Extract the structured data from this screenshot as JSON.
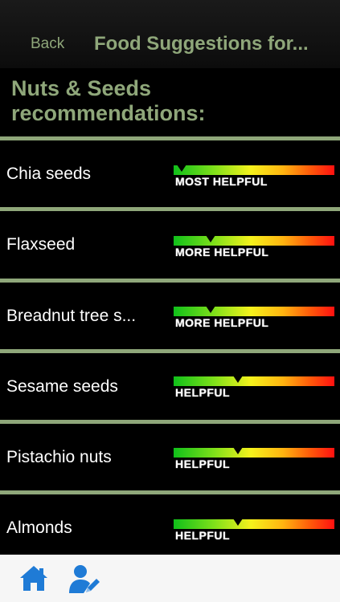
{
  "nav": {
    "back_label": "Back",
    "title": "Food Suggestions for..."
  },
  "heading": "Nuts & Seeds recommendations:",
  "items": [
    {
      "name": "Chia seeds",
      "rating": "MOST HELPFUL",
      "level": 0.02
    },
    {
      "name": "Flaxseed",
      "rating": "MORE HELPFUL",
      "level": 0.2
    },
    {
      "name": "Breadnut tree s...",
      "rating": "MORE HELPFUL",
      "level": 0.2
    },
    {
      "name": "Sesame seeds",
      "rating": "HELPFUL",
      "level": 0.37
    },
    {
      "name": "Pistachio nuts",
      "rating": "HELPFUL",
      "level": 0.37
    },
    {
      "name": "Almonds",
      "rating": "HELPFUL",
      "level": 0.37
    }
  ],
  "colors": {
    "accent": "#8fa77a",
    "background": "#000000",
    "tab_icon": "#1f7bd6"
  },
  "tabbar": {
    "icons": [
      "home-icon",
      "edit-profile-icon"
    ]
  }
}
